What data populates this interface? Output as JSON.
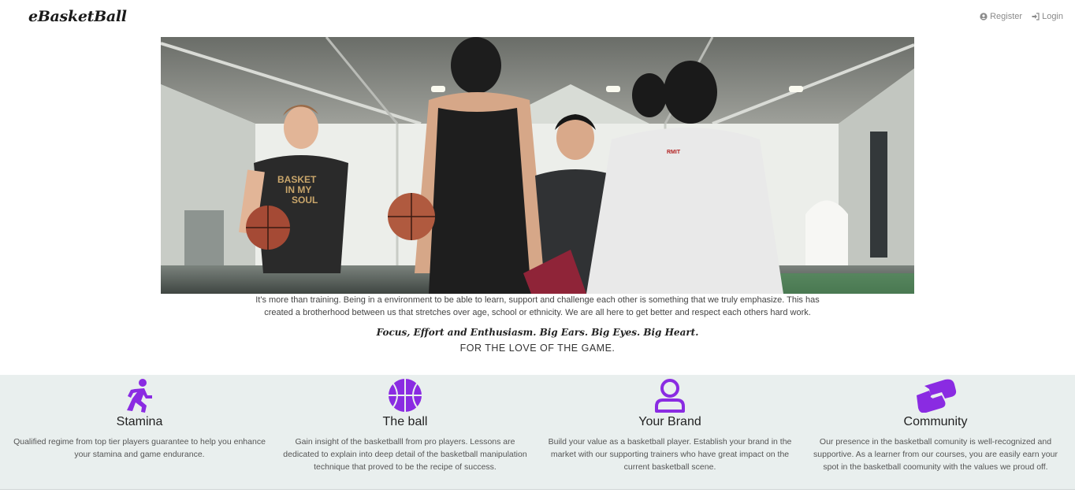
{
  "navbar": {
    "brand": "eBasketBall",
    "register_label": "Register",
    "login_label": "Login"
  },
  "hero": {
    "shirt_text_1": "BASKET",
    "shirt_text_2": "IN MY",
    "shirt_text_3": "SOUL",
    "logo_text": "RMIT"
  },
  "intro": {
    "text": "It's more than training. Being in a environment to be able to learn, support and challenge each other is something that we truly emphasize. This has created a brotherhood between us that stretches over age, school or ethnicity. We are all here to get better and respect each others hard work."
  },
  "motto": "Focus, Effort and Enthusiasm. Big Ears. Big Eyes. Big Heart.",
  "tagline": "FOR THE LOVE OF THE GAME.",
  "colors": {
    "accent": "#8a2be2",
    "feature_bg": "#e9efee"
  },
  "features": [
    {
      "icon": "running-icon",
      "title": "Stamina",
      "text": "Qualified regime from top tier players guarantee to help you enhance your stamina and game endurance."
    },
    {
      "icon": "basketball-icon",
      "title": "The ball",
      "text": "Gain insight of the basketballl from pro players. Lessons are dedicated to explain into deep detail of the basketball manipulation technique that proved to be the recipe of success."
    },
    {
      "icon": "user-icon",
      "title": "Your Brand",
      "text": "Build your value as a basketball player. Establish your brand in the market with our supporting trainers who have great impact on the current basketball scene."
    },
    {
      "icon": "handshake-icon",
      "title": "Community",
      "text": "Our presence in the basketball comunity is well-recognized and supportive. As a learner from our courses, you are easily earn your spot in the basketball coomunity with the values we proud off."
    }
  ]
}
